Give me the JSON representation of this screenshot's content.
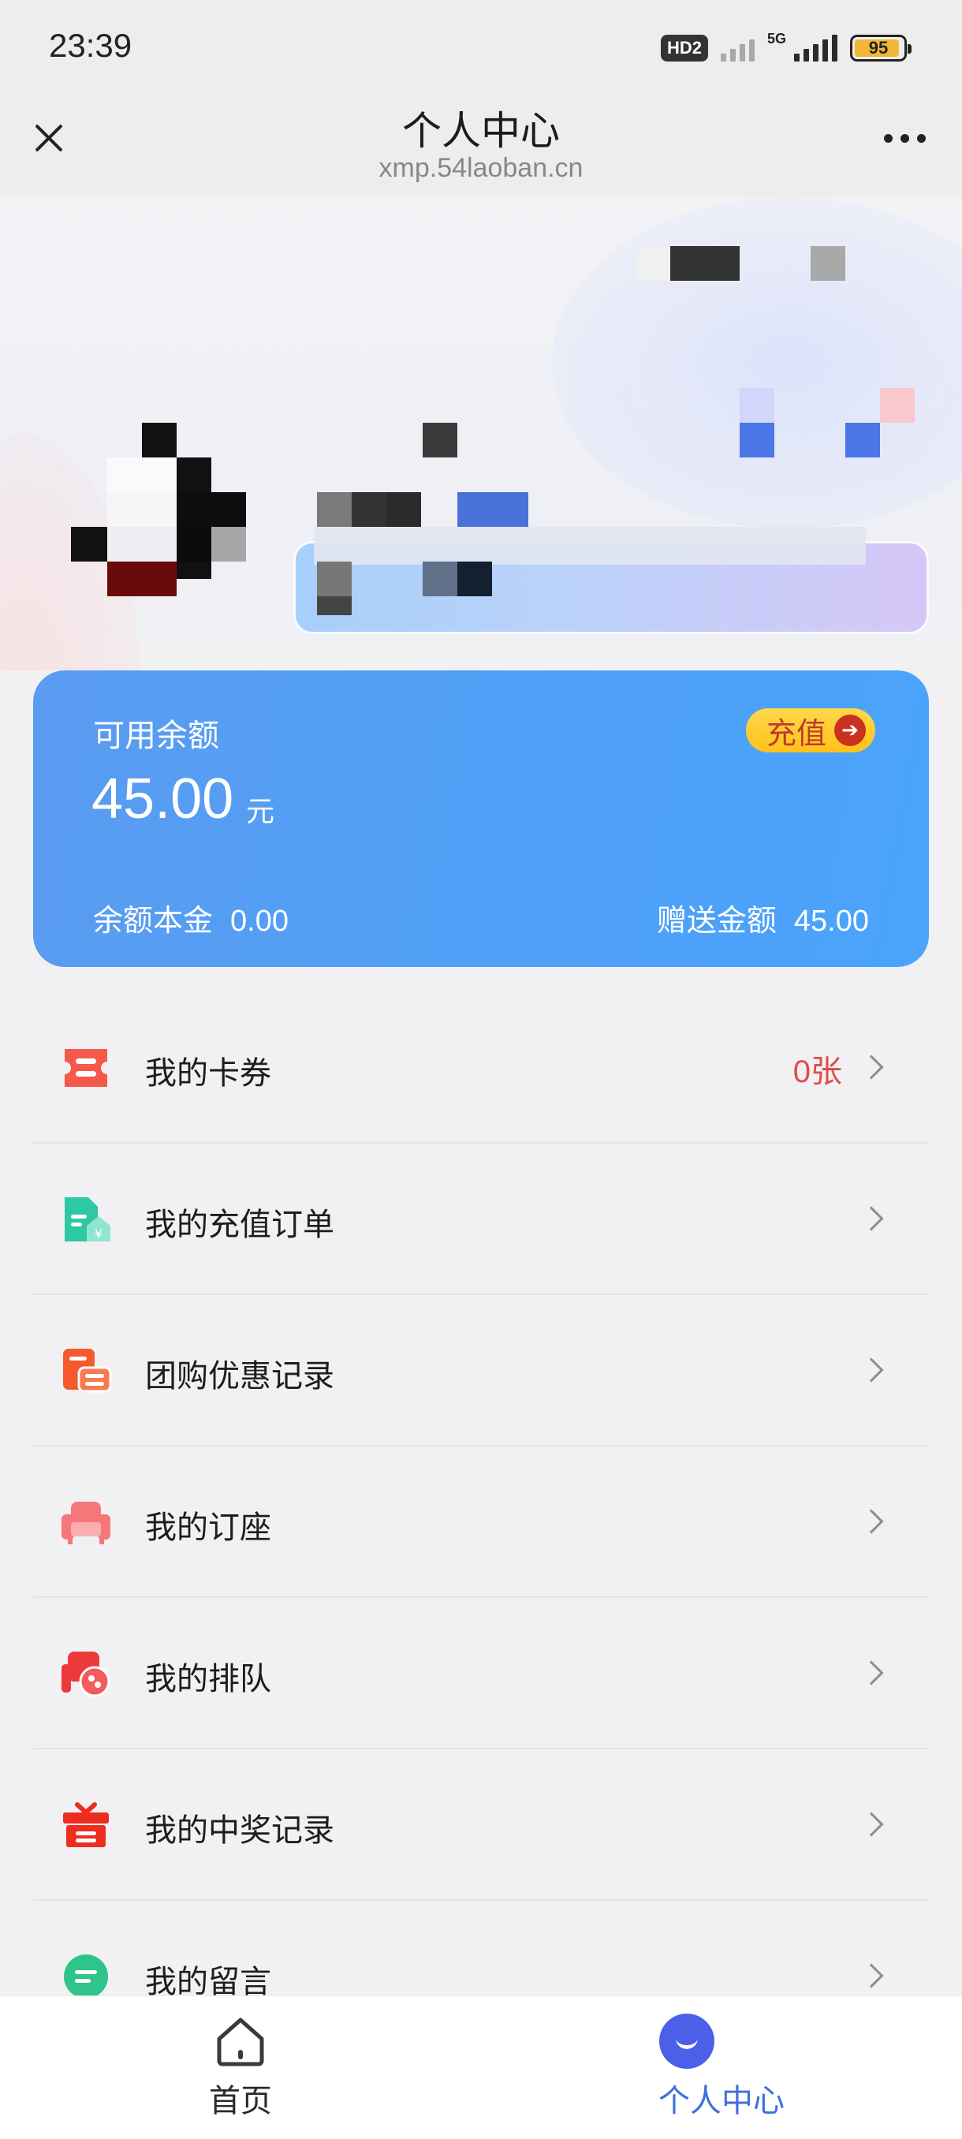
{
  "status_bar": {
    "time": "23:39",
    "hd_label": "HD2",
    "net_label": "5G",
    "battery": "95"
  },
  "title_bar": {
    "title": "个人中心",
    "url": "xmp.54laoban.cn"
  },
  "balance": {
    "label": "可用余额",
    "amount": "45.00",
    "unit": "元",
    "recharge_label": "充值",
    "recharge_arrow": "➔",
    "principal_label": "余额本金",
    "principal_value": "0.00",
    "gift_label": "赠送金额",
    "gift_value": "45.00"
  },
  "menu": [
    {
      "label": "我的卡券",
      "extra": "0张",
      "icon": "coupon-icon",
      "color": "#f4594a"
    },
    {
      "label": "我的充值订单",
      "extra": "",
      "icon": "recharge-order-icon",
      "color": "#2fc8a4"
    },
    {
      "label": "团购优惠记录",
      "extra": "",
      "icon": "group-buy-icon",
      "color": "#f55a2c"
    },
    {
      "label": "我的订座",
      "extra": "",
      "icon": "seat-icon",
      "color": "#f7767a"
    },
    {
      "label": "我的排队",
      "extra": "",
      "icon": "queue-icon",
      "color": "#ec3a3a"
    },
    {
      "label": "我的中奖记录",
      "extra": "",
      "icon": "gift-icon",
      "color": "#ec2d20"
    },
    {
      "label": "我的留言",
      "extra": "",
      "icon": "message-icon",
      "color": "#2fc48a"
    }
  ],
  "tabs": [
    {
      "label": "首页",
      "icon": "home-icon",
      "active": false
    },
    {
      "label": "个人中心",
      "icon": "profile-icon",
      "active": true
    }
  ],
  "colors": {
    "card_blue": "#4f9ff6",
    "accent_blue": "#3f6ee0",
    "recharge_yellow": "#ffc21a",
    "extra_red": "#e24a4a"
  }
}
